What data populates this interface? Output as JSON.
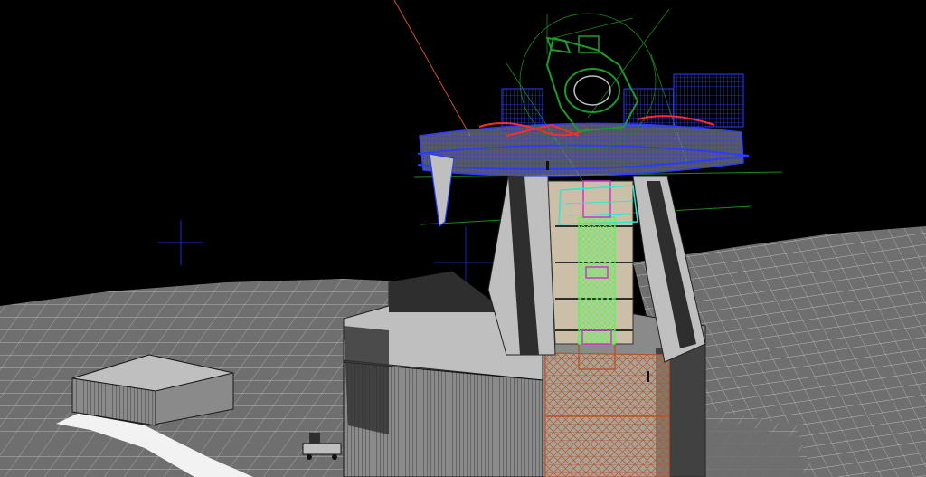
{
  "viewport": {
    "background": "#000000"
  },
  "colors": {
    "terrain_fill": "#6f6f6f",
    "terrain_wire": "#d8d8d8",
    "building_fill": "#8a8a8a",
    "building_light": "#bfbfbf",
    "building_dark": "#2e2e2e",
    "beige": "#cbbfa7",
    "platform_wire": "#2b3cff",
    "telescope_green": "#1f9a2a",
    "bright_green": "#4cff4c",
    "cyan": "#2ee6d4",
    "magenta": "#d233d2",
    "copper": "#b8562a",
    "red": "#ff2a2a",
    "guide_green": "#1a8a1a",
    "guide_blue": "#1e2fd0",
    "guide_orange": "#c8502a",
    "path_white": "#f2f2f2"
  },
  "icons": {
    "view_cross_left": "crosshair-icon",
    "view_cross_mid": "crosshair-icon"
  }
}
